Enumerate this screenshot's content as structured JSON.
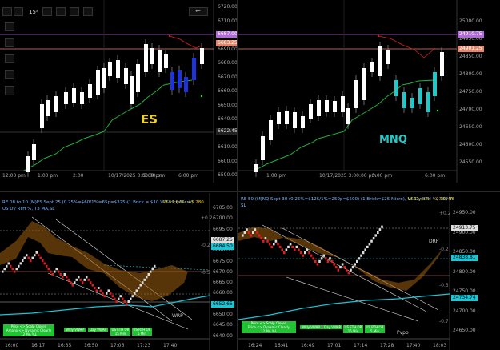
{
  "toolbar": {
    "timeframe": "15²",
    "back_arrow": "←"
  },
  "colors": {
    "bg": "#000000",
    "candle_up": "#ffffff",
    "candle_down_es": "#1e33d8",
    "candle_down_mnq": "#26c6c6",
    "trail": "#22b13a",
    "renko_up": "#dddddd",
    "renko_down": "#e31b1b",
    "channel": "#a06010",
    "vwap": "#18c6d6",
    "accent_label": "#f1d21f"
  },
  "es": {
    "symbol": "ES",
    "y_ticks": [
      "6720.00",
      "6710.00",
      "6700.00",
      "6690.00",
      "6680.00",
      "6670.00",
      "6660.00",
      "6650.00",
      "6640.00",
      "6630.00",
      "6610.00",
      "6600.00",
      "6590.00"
    ],
    "price_tags": [
      "6687.00",
      "6683.25",
      "6622.45"
    ],
    "x_ticks": [
      "12:00 pm",
      "1:00 pm",
      "2:00",
      "10/17/2025 3:00:00 pm",
      "5:00 pm",
      "6:00 pm"
    ]
  },
  "mnq": {
    "symbol": "MNQ",
    "y_ticks": [
      "25000.00",
      "24950.00",
      "24850.00",
      "24800.00",
      "24750.00",
      "24700.00",
      "24650.00",
      "24600.00",
      "24550.00"
    ],
    "price_tags": [
      "24910.75",
      "24901.25"
    ],
    "x_ticks": [
      "1:00 pm",
      "10/17/2025 3:00:00 pm",
      "5:00 pm",
      "6:00 pm"
    ]
  },
  "renko_es": {
    "title_line1": "RE 08 to 10 (M)ES Sept 25 (0.25%=$60/1%=65p=$325)(1 Brick = $10 W Stock Micro)",
    "title_line2": "US Dy RTH %, T3 MA,SL",
    "title_right": "W 11;(a%: +5.280",
    "y_ticks": [
      "6705.00",
      "6700.00",
      "6695.00",
      "6690.00",
      "6680.00",
      "6675.00",
      "6670.00",
      "6665.00",
      "6660.00",
      "6655.00",
      "6650.00",
      "6645.00",
      "6640.00"
    ],
    "pct_ticks": [
      "+0.5",
      "+0.2",
      "-0.2",
      "-0.5"
    ],
    "price_tags": [
      "6687.25",
      "6684.50",
      "6652.65"
    ],
    "x_ticks": [
      "16:00",
      "16:17",
      "16:35",
      "16:50",
      "17:06",
      "17:23",
      "17:40"
    ],
    "buttons": [
      "Price <> Scalp Closed\nAmanp <> Dynamic Clearly\n12 MA %L",
      "Wkly VWAP",
      "Day VWAP",
      "US ETH OR\n15 Min",
      "US RTH OR\n5 Min"
    ],
    "wrp_label": "WRP"
  },
  "renko_mnq": {
    "title_line1": "RE 50 (M)NQ Sept 30 (0.25%=$125/1%=250p=$500)  (1 Brick=$25 Micro), US Dy RTH %, T3 MA",
    "title_line2": "SL",
    "title_right": "W 11;(a%: +0.00,-86",
    "y_ticks": [
      "24950.00",
      "24900.00",
      "24850.00",
      "24800.00",
      "24750.00",
      "24700.00",
      "24650.00"
    ],
    "pct_ticks": [
      "+0.2",
      "-0.2",
      "-0.5",
      "-0.7"
    ],
    "price_tags": [
      "24913.75",
      "24838.81",
      "24734.74"
    ],
    "x_ticks": [
      "16:24",
      "16:41",
      "16:49",
      "17:01",
      "17:14",
      "17:28",
      "17:40",
      "18:03"
    ],
    "buttons": [
      "Price <> Scalp Closed\nPrice <> Dynamic Clearly\n12 MA %L",
      "Wkly VWAP",
      "Day VWAP",
      "US ETH OR\n15 Min",
      "US RTH OR\n5 Min"
    ],
    "drp_label": "DRP",
    "pvpo_label": "Pvpo"
  }
}
